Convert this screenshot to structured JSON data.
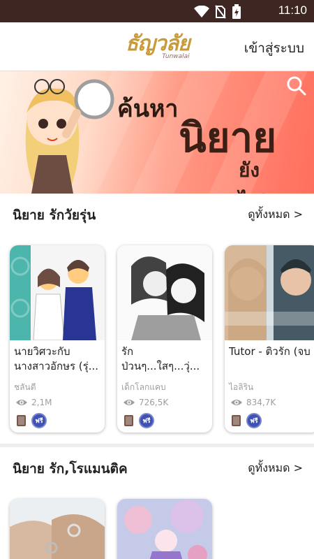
{
  "status_bar": {
    "time": "11:10"
  },
  "header": {
    "logo_text": "ธัญวลัย",
    "logo_sub": "Tunwalai",
    "login_label": "เข้าสู่ระบบ"
  },
  "banner": {
    "line1": "ค้นหา",
    "line2": "นิยาย",
    "line3": "ยังไง?"
  },
  "sections": [
    {
      "title": "นิยาย รักวัยรุ่น",
      "see_all": "ดูทั้งหมด >",
      "cards": [
        {
          "title": "นายวิศวะกับนางสาวอักษร (รุ่...",
          "author": "ชลันตี",
          "views": "2,1M",
          "free": "ฟรี"
        },
        {
          "title": "รัก ป่วนๆ...ใสๆ...วุ่...",
          "author": "เด็กโลกแคบ",
          "views": "726,5K",
          "free": "ฟรี"
        },
        {
          "title": "Tutor - ติวรัก (จบ",
          "author": "ไอลิริน",
          "views": "834,7K",
          "free": "ฟรี"
        }
      ]
    },
    {
      "title": "นิยาย รัก,โรแมนติค",
      "see_all": "ดูทั้งหมด >"
    }
  ],
  "colors": {
    "status_bar": "#3e2723",
    "logo": "#c89a3a",
    "free_badge": "#3f51b5"
  }
}
